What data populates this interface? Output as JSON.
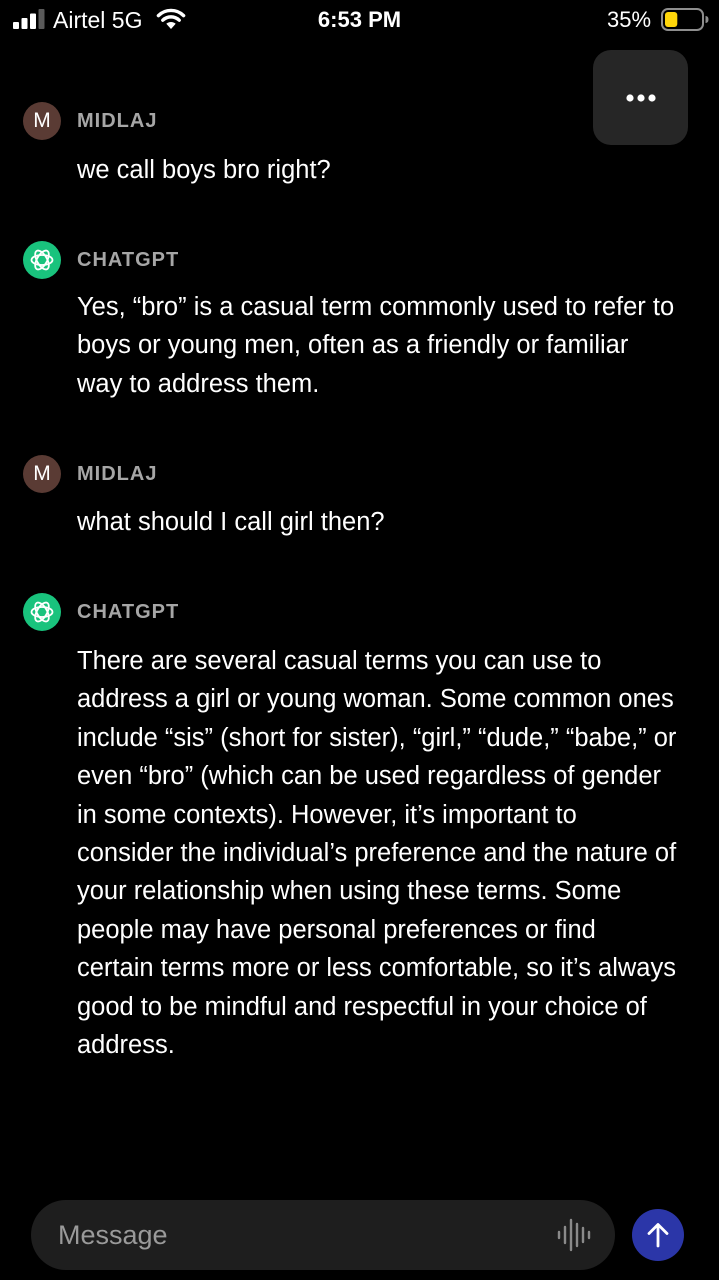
{
  "status_bar": {
    "carrier": "Airtel 5G",
    "time": "6:53 PM",
    "battery": "35%",
    "battery_level": 0.35,
    "battery_color": "#ffd60a"
  },
  "menu": {
    "icon": "ellipsis-icon"
  },
  "messages": [
    {
      "sender": "MIDLAJ",
      "avatar": "M",
      "avatar_color": "#5a3b34",
      "text": "we call boys bro right?"
    },
    {
      "sender": "CHATGPT",
      "avatar_icon": "openai-logo-icon",
      "avatar_color": "#19c37d",
      "text": "Yes, “bro” is a casual term commonly used to refer to boys or young men, often as a friendly or familiar way to address them."
    },
    {
      "sender": "MIDLAJ",
      "avatar": "M",
      "avatar_color": "#5a3b34",
      "text": "what should I call girl then?"
    },
    {
      "sender": "CHATGPT",
      "avatar_icon": "openai-logo-icon",
      "avatar_color": "#19c37d",
      "text": "There are several casual terms you can use to address a girl or young woman. Some common ones include “sis” (short for sister), “girl,” “dude,” “babe,” or even “bro” (which can be used regardless of gender in some contexts). However, it’s important to consider the individual’s preference and the nature of your relationship when using these terms. Some people may have personal preferences or find certain terms more or less comfortable, so it’s always good to be mindful and respectful in your choice of address."
    }
  ],
  "composer": {
    "placeholder": "Message",
    "value": "",
    "voice_icon": "voice-waveform-icon",
    "send_icon": "arrow-up-icon",
    "send_color": "#2b36a8"
  }
}
